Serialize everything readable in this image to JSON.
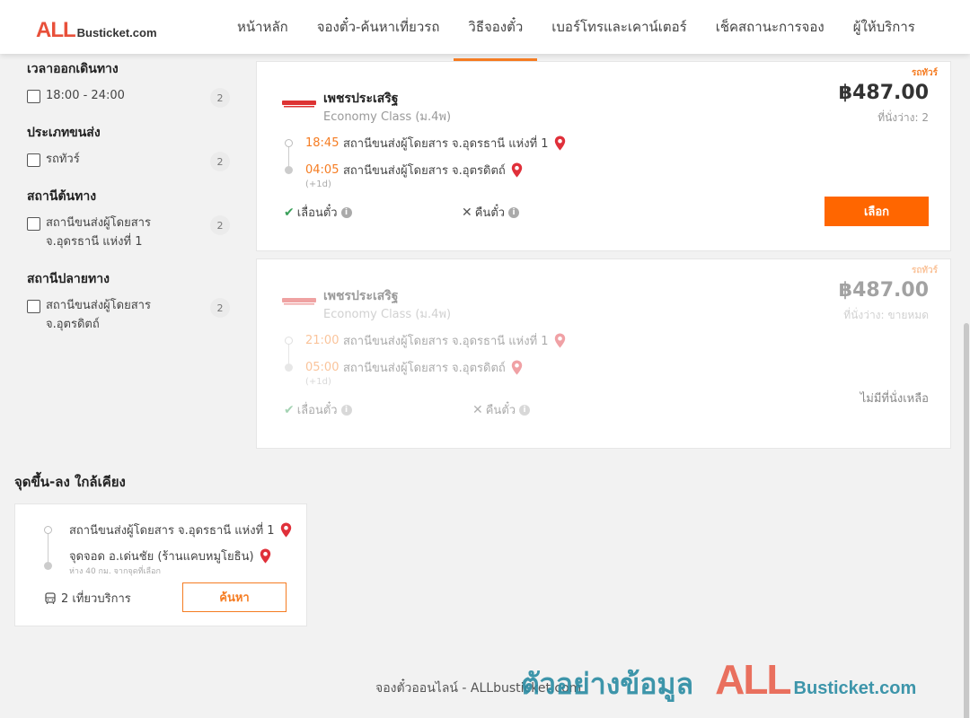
{
  "header": {
    "logo_all": "ALL",
    "logo_rest": "Busticket.com",
    "nav": [
      {
        "label": "หน้าหลัก"
      },
      {
        "label": "จองตั๋ว-ค้นหาเที่ยวรถ"
      },
      {
        "label": "วิธีจองตั๋ว"
      },
      {
        "label": "เบอร์โทรและเคาน์เตอร์"
      },
      {
        "label": "เช็คสถานะการจอง"
      },
      {
        "label": "ผู้ให้บริการ"
      }
    ],
    "active_nav": "วิธีจองตั๋ว"
  },
  "filters": {
    "departure_time": {
      "title": "เวลาออกเดินทาง",
      "options": [
        {
          "label": "18:00 - 24:00",
          "count": "2"
        }
      ]
    },
    "transport_type": {
      "title": "ประเภทขนส่ง",
      "options": [
        {
          "label": "รถทัวร์",
          "count": "2"
        }
      ]
    },
    "origin": {
      "title": "สถานีต้นทาง",
      "options": [
        {
          "label": "สถานีขนส่งผู้โดยสาร จ.อุดรธานี แห่งที่ 1",
          "count": "2"
        }
      ]
    },
    "destination": {
      "title": "สถานีปลายทาง",
      "options": [
        {
          "label": "สถานีขนส่งผู้โดยสาร จ.อุตรดิตถ์",
          "count": "2"
        }
      ]
    }
  },
  "trips": [
    {
      "type_label": "รถทัวร์",
      "operator": "เพชรประเสริฐ",
      "class": "Economy Class (ม.4พ)",
      "price": "฿487.00",
      "seats": "ที่นั่งว่าง: 2",
      "depart_time": "18:45",
      "depart_station": "สถานีขนส่งผู้โดยสาร จ.อุดรธานี แห่งที่ 1",
      "arrive_time": "04:05",
      "arrive_station": "สถานีขนส่งผู้โดยสาร จ.อุตรดิตถ์",
      "next_day": "(+1d)",
      "policy_change": "เลื่อนตั๋ว",
      "policy_refund": "คืนตั๋ว",
      "select_label": "เลือก"
    },
    {
      "type_label": "รถทัวร์",
      "operator": "เพชรประเสริฐ",
      "class": "Economy Class (ม.4พ)",
      "price": "฿487.00",
      "seats": "ที่นั่งว่าง: ขายหมด",
      "depart_time": "21:00",
      "depart_station": "สถานีขนส่งผู้โดยสาร จ.อุดรธานี แห่งที่ 1",
      "arrive_time": "05:00",
      "arrive_station": "สถานีขนส่งผู้โดยสาร จ.อุตรดิตถ์",
      "next_day": "(+1d)",
      "policy_change": "เลื่อนตั๋ว",
      "policy_refund": "คืนตั๋ว",
      "soldout_label": "ไม่มีที่นั่งเหลือ"
    }
  ],
  "nearby": {
    "title": "จุดขึ้น-ลง ใกล้เคียง",
    "from": "สถานีขนส่งผู้โดยสาร จ.อุดรธานี แห่งที่ 1",
    "to": "จุดจอด อ.เด่นชัย (ร้านแคบหมูโยธิน)",
    "note": "ห่าง 40 กม. จากจุดที่เลือก",
    "services": "2 เที่ยวบริการ",
    "search_label": "ค้นหา"
  },
  "footer": {
    "text": "จองตั๋วออนไลน์ - ALLbusticket.com"
  },
  "watermark": {
    "thai": "ตัวอย่างข้อมูล",
    "all": "ALL",
    "rest": "Busticket.com"
  },
  "colors": {
    "accent": "#ff6600",
    "brand_red": "#e8503a",
    "pin": "#e0303a",
    "check": "#3aa05a"
  }
}
